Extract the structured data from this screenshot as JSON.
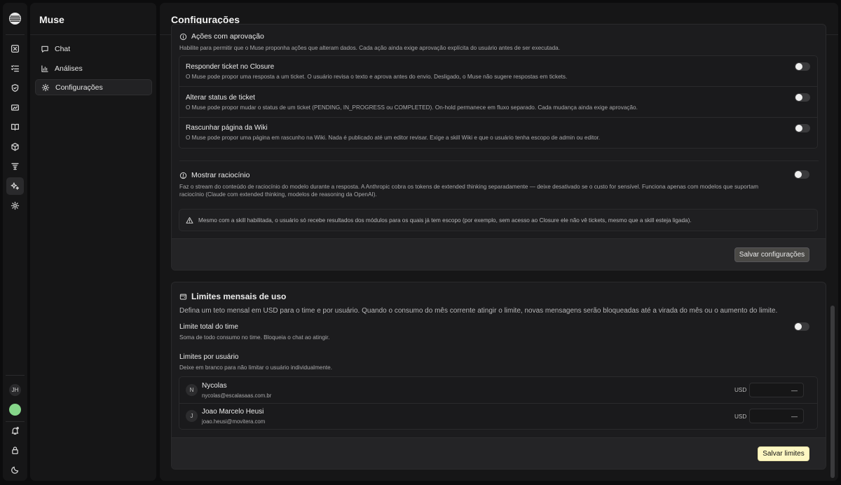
{
  "rail": {
    "icons": [
      "logo-icon",
      "close-square-icon",
      "list-check-icon",
      "shield-icon",
      "card-icon",
      "book-icon",
      "cube-icon",
      "filter-icon",
      "sparkles-icon",
      "gear-icon"
    ],
    "avatar_initials": "JH",
    "bottom_icons": [
      "notification-icon",
      "lock-icon",
      "moon-icon"
    ]
  },
  "sidebar": {
    "title": "Muse",
    "items": [
      {
        "label": "Chat",
        "icon": "chat-icon"
      },
      {
        "label": "Análises",
        "icon": "chart-icon"
      },
      {
        "label": "Configurações",
        "icon": "gear-icon",
        "active": true
      }
    ]
  },
  "main": {
    "title": "Configurações",
    "actions_section": {
      "heading": "Ações com aprovação",
      "description": "Habilite para permitir que o Muse proponha ações que alteram dados. Cada ação ainda exige aprovação explícita do usuário antes de ser executada.",
      "items": [
        {
          "title": "Responder ticket no Closure",
          "description": "O Muse pode propor uma resposta a um ticket. O usuário revisa o texto e aprova antes do envio. Desligado, o Muse não sugere respostas em tickets.",
          "enabled": false
        },
        {
          "title": "Alterar status de ticket",
          "description": "O Muse pode propor mudar o status de um ticket (PENDING, IN_PROGRESS ou COMPLETED). On-hold permanece em fluxo separado. Cada mudança ainda exige aprovação.",
          "enabled": false
        },
        {
          "title": "Rascunhar página da Wiki",
          "description": "O Muse pode propor uma página em rascunho na Wiki. Nada é publicado até um editor revisar. Exige a skill Wiki e que o usuário tenha escopo de admin ou editor.",
          "enabled": false
        }
      ]
    },
    "reasoning": {
      "heading": "Mostrar raciocínio",
      "description_line1": "Faz o stream do conteúdo de raciocínio do modelo durante a resposta. A Anthropic cobra os tokens de extended thinking separadamente — deixe desativado se o custo for sensível. Funciona apenas com modelos que suportam",
      "description_line2": "raciocínio (Claude com extended thinking, modelos de reasoning da OpenAI).",
      "enabled": false
    },
    "notice": "Mesmo com a skill habilitada, o usuário só recebe resultados dos módulos para os quais já tem escopo (por exemplo, sem acesso ao Closure ele não vê tickets, mesmo que a skill esteja ligada).",
    "save_settings_label": "Salvar configurações",
    "limits": {
      "heading": "Limites mensais de uso",
      "description": "Defina um teto mensal em USD para o time e por usuário. Quando o consumo do mês corrente atingir o limite, novas mensagens serão bloqueadas até a virada do mês ou o aumento do limite.",
      "team_limit_title": "Limite total do time",
      "team_limit_desc": "Soma de todo consumo no time. Bloqueia o chat ao atingir.",
      "team_limit_enabled": false,
      "per_user_title": "Limites por usuário",
      "per_user_desc": "Deixe em branco para não limitar o usuário individualmente.",
      "currency": "USD",
      "users": [
        {
          "initial": "N",
          "name": "Nycolas",
          "email": "nycolas@escalasaas.com.br",
          "placeholder": "—"
        },
        {
          "initial": "J",
          "name": "Joao Marcelo Heusi",
          "email": "joao.heusi@movitera.com",
          "placeholder": "—"
        }
      ],
      "save_label": "Salvar limites"
    }
  }
}
